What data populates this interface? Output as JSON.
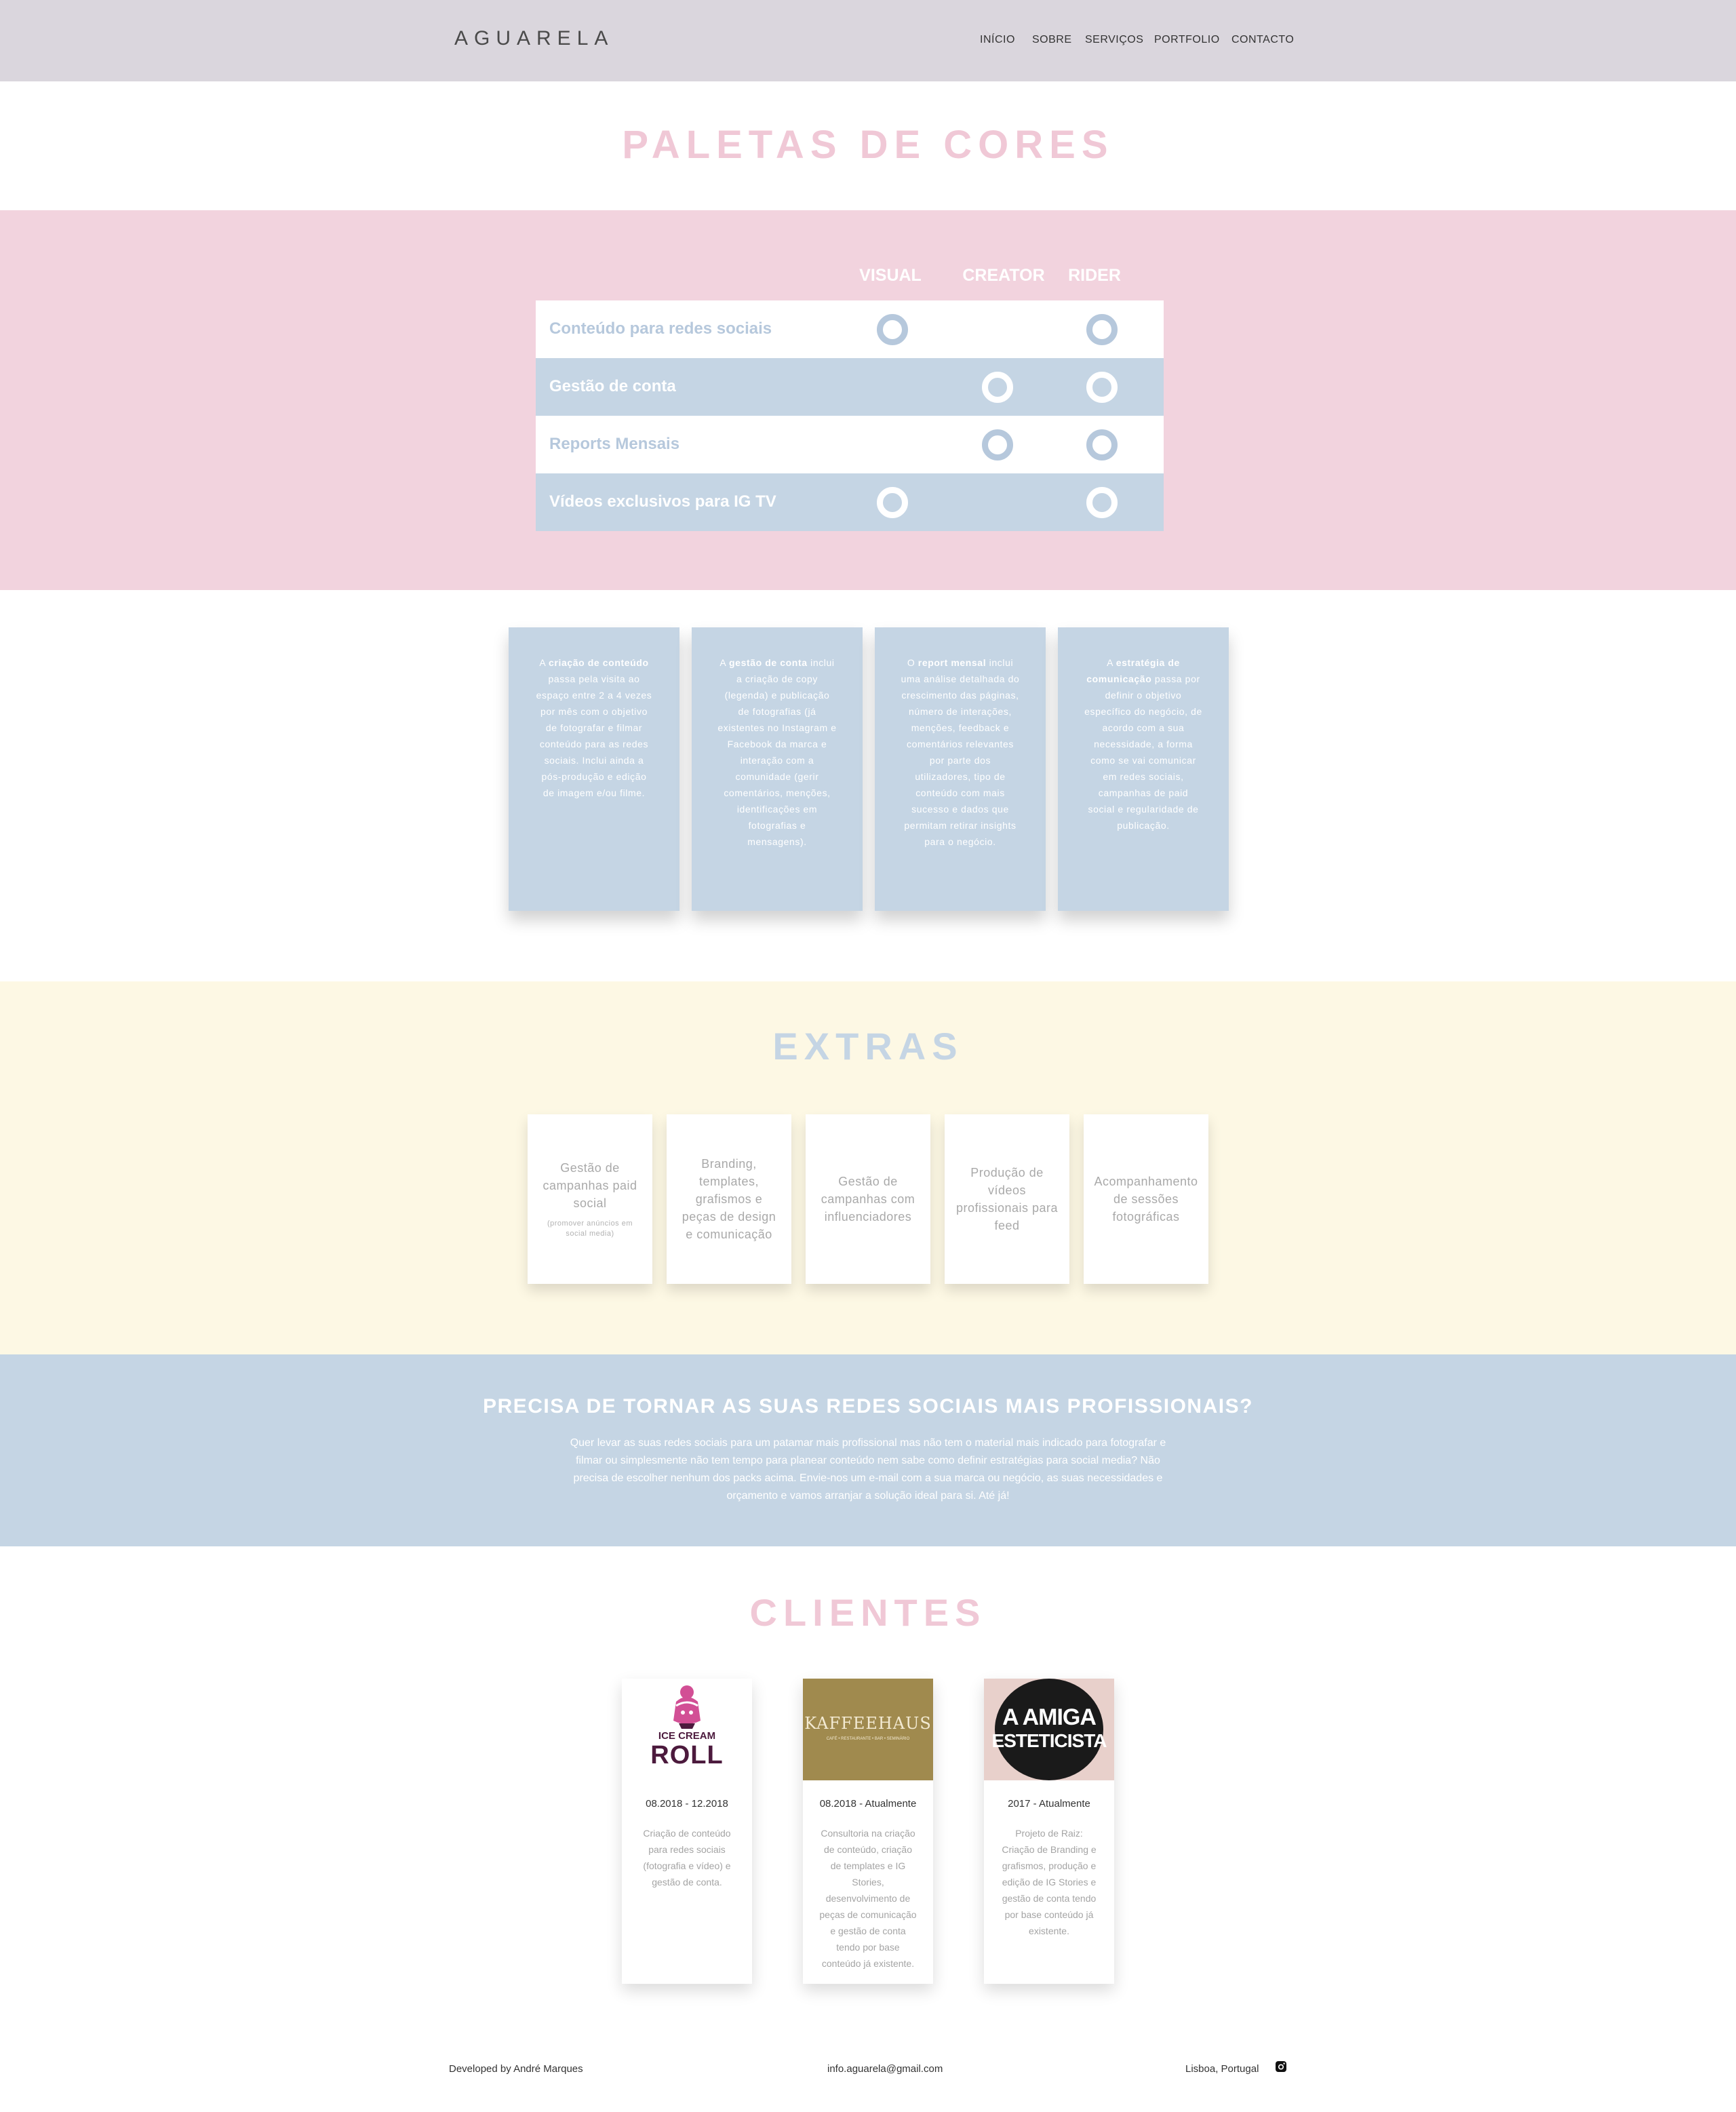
{
  "header": {
    "logo": "AGUARELA",
    "nav": [
      "INÍCIO",
      "SOBRE",
      "SERVIÇOS",
      "PORTFOLIO",
      "CONTACTO"
    ]
  },
  "palettes": {
    "title": "PALETAS DE CORES",
    "columns": [
      "VISUAL",
      "CREATOR",
      "RIDER"
    ],
    "rows": [
      {
        "label": "Conteúdo para redes sociais",
        "visual": true,
        "creator": false,
        "rider": true
      },
      {
        "label": "Gestão de conta",
        "visual": false,
        "creator": true,
        "rider": true
      },
      {
        "label": "Reports Mensais",
        "visual": false,
        "creator": true,
        "rider": true
      },
      {
        "label": "Vídeos exclusivos para IG TV",
        "visual": true,
        "creator": false,
        "rider": true
      }
    ]
  },
  "descriptions": [
    {
      "pre": "A ",
      "bold": "criação de conteúdo",
      "post": " passa pela visita ao espaço entre 2 a 4 vezes por mês com o objetivo de fotografar e filmar conteúdo para as redes sociais. Inclui ainda a pós-produção e edição de imagem e/ou filme."
    },
    {
      "pre": "A ",
      "bold": "gestão de conta",
      "post": " inclui a criação de copy (legenda) e publicação de fotografias (já existentes no Instagram e Facebook da marca e interação com a comunidade (gerir comentários, menções, identificações em fotografias e mensagens)."
    },
    {
      "pre": "O ",
      "bold": "report mensal",
      "post": " inclui uma análise detalhada do crescimento das páginas, número de interações, menções, feedback e comentários relevantes por parte dos utilizadores, tipo de conteúdo com mais sucesso e dados que permitam retirar insights para o negócio."
    },
    {
      "pre": "A ",
      "bold": "estratégia de comunicação",
      "post": " passa por definir o objetivo específico do negócio, de acordo com a sua necessidade, a forma como se vai comunicar em redes sociais, campanhas de paid social e regularidade de publicação."
    }
  ],
  "extras": {
    "title": "EXTRAS",
    "items": [
      {
        "text": "Gestão de campanhas paid social",
        "note": "(promover anúncios em social media)"
      },
      {
        "text": "Branding, templates, grafismos e peças de design e comunicação",
        "note": ""
      },
      {
        "text": "Gestão de campanhas com influenciadores",
        "note": ""
      },
      {
        "text": "Produção de vídeos profissionais para feed",
        "note": ""
      },
      {
        "text": "Acompanhamento de sessões fotográficas",
        "note": ""
      }
    ]
  },
  "cta": {
    "title": "PRECISA DE TORNAR AS SUAS REDES SOCIAIS MAIS PROFISSIONAIS?",
    "text": "Quer levar as suas redes sociais para um patamar mais profissional mas não tem o material mais indicado para fotografar e filmar ou simplesmente não tem tempo para planear conteúdo nem sabe como definir estratégias para social media? Não precisa de escolher nenhum dos packs acima. Envie-nos um e-mail com a sua marca ou negócio, as suas necessidades e orçamento e vamos arranjar a solução ideal para si. Até já!"
  },
  "clients": {
    "title": "CLIENTES",
    "items": [
      {
        "logo_line1": "ICE CREAM",
        "logo_line2": "ROLL",
        "date": "08.2018 - 12.2018",
        "desc": "Criação de conteúdo para redes sociais (fotografia e vídeo) e gestão de conta."
      },
      {
        "logo_line1": "KAFFEEHAUS",
        "logo_line2": "CAFÉ • RESTAURANTE • BAR • SEMINÁRIO",
        "date": "08.2018 - Atualmente",
        "desc": "Consultoria na criação de conteúdo, criação de templates e IG Stories, desenvolvimento de peças de comunicação e gestão de conta tendo por base conteúdo já existente."
      },
      {
        "logo_line1": "A AMIGA",
        "logo_line2": "ESTETICISTA",
        "date": "2017 - Atualmente",
        "desc": "Projeto de Raiz: Criação de Branding e grafismos, produção e edição de IG Stories e gestão de conta tendo por base conteúdo já existente."
      }
    ]
  },
  "footer": {
    "developer": "Developed by André Marques",
    "email": "info.aguarela@gmail.com",
    "location": "Lisboa, Portugal",
    "icon": "instagram-icon"
  },
  "colors": {
    "header_bg": "#dad6dd",
    "pink": "#f2d3de",
    "blue": "#c5d5e4",
    "cream": "#fdf8e4",
    "title_pink": "#f0c8d6",
    "title_blue": "#c5d5e4"
  }
}
